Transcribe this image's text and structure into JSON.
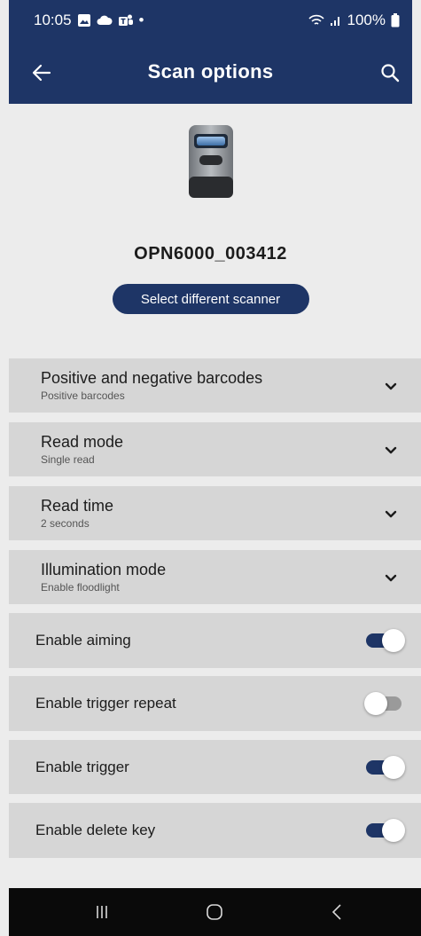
{
  "status_bar": {
    "time": "10:05",
    "dot": "•",
    "battery_text": "100%",
    "icons": [
      "gallery-icon",
      "cloud-icon",
      "teams-icon",
      "wifi-icon",
      "signal-icon",
      "battery-icon"
    ]
  },
  "app_bar": {
    "title": "Scan options",
    "back_icon": "arrow-left-icon",
    "search_icon": "search-icon"
  },
  "scanner": {
    "device_name": "OPN6000_003412",
    "select_button_label": "Select different scanner"
  },
  "settings": {
    "dropdowns": [
      {
        "label": "Positive and negative barcodes",
        "value": "Positive barcodes"
      },
      {
        "label": "Read mode",
        "value": "Single read"
      },
      {
        "label": "Read time",
        "value": "2 seconds"
      },
      {
        "label": "Illumination mode",
        "value": "Enable floodlight"
      }
    ],
    "toggles": [
      {
        "label": "Enable aiming",
        "on": true
      },
      {
        "label": "Enable trigger repeat",
        "on": false
      },
      {
        "label": "Enable trigger",
        "on": true
      },
      {
        "label": "Enable delete key",
        "on": true
      }
    ]
  },
  "nav_bar": {
    "icons": [
      "recent-apps-icon",
      "home-icon",
      "back-icon"
    ]
  },
  "colors": {
    "primary": "#1e3566",
    "row_background": "#d6d6d6",
    "page_background": "#ececec",
    "nav_background": "#0a0a0a"
  }
}
